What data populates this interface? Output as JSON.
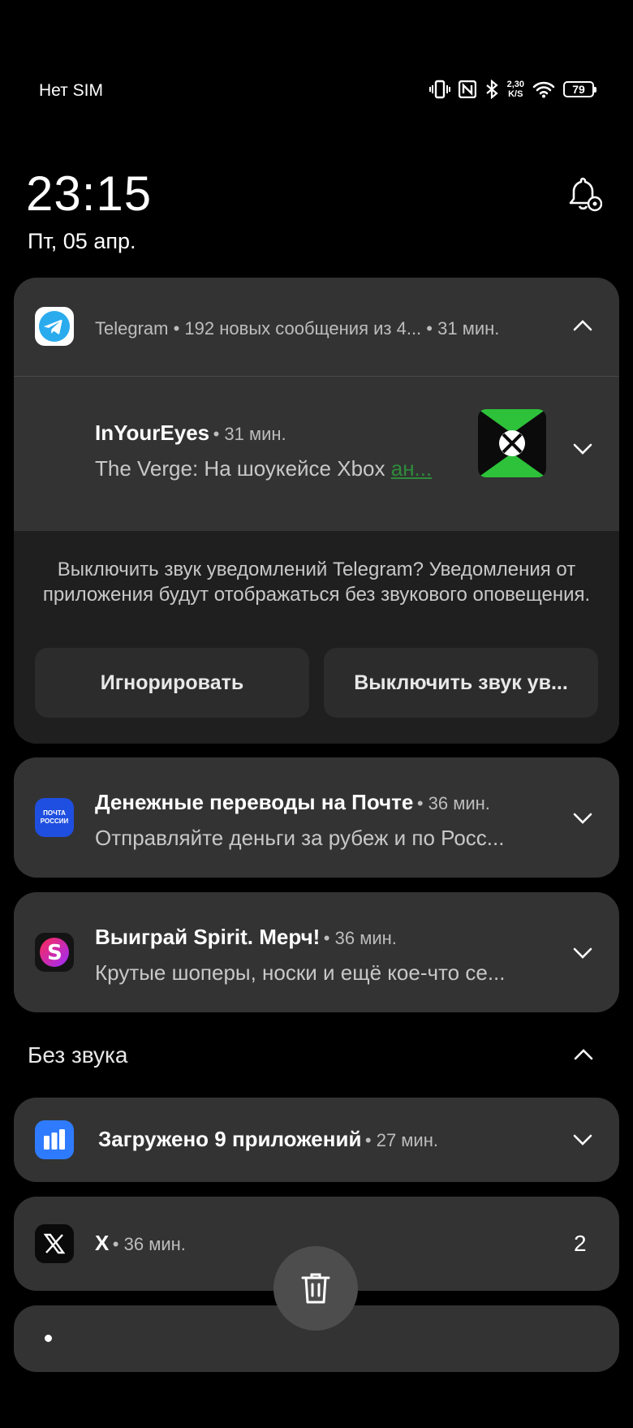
{
  "status_bar": {
    "carrier": "Нет SIM",
    "speed_value": "2,30",
    "speed_unit": "K/S",
    "battery": "79"
  },
  "lockscreen": {
    "time": "23:15",
    "date": "Пт, 05 апр."
  },
  "telegram": {
    "app_name": "Telegram",
    "summary": "• 192 новых сообщения из 4...",
    "time": "• 31 мин.",
    "message": {
      "sender": "InYourEyes",
      "time": "• 31 мин.",
      "text": "The Verge: На шоукейсе Xbox",
      "link_fragment": "ан..."
    },
    "mute_prompt": "Выключить звук уведомлений Telegram? Уведомления от приложения будут отображаться без звукового оповещения.",
    "ignore_label": "Игнорировать",
    "mute_label": "Выключить звук ув..."
  },
  "notifications": [
    {
      "title": "Денежные переводы на Почте",
      "time": "• 36 мин.",
      "text": "Отправляйте деньги за рубеж и по Росс...",
      "icon_text": "ПОЧТА РОССИИ"
    },
    {
      "title": "Выиграй Spirit. Мерч!",
      "time": "• 36 мин.",
      "text": "Крутые шоперы, носки и ещё кое-что се..."
    }
  ],
  "silent": {
    "header": "Без звука",
    "downloads": {
      "title": "Загружено 9 приложений",
      "time": "• 27 мин."
    },
    "x_app": {
      "title": "X",
      "time": "• 36 мин.",
      "count": "2"
    }
  },
  "colors": {
    "card": "#333333",
    "telegram_blue": "#2aabee",
    "xbox_green": "#2ec13a",
    "pochta_blue": "#1f4fe0"
  }
}
